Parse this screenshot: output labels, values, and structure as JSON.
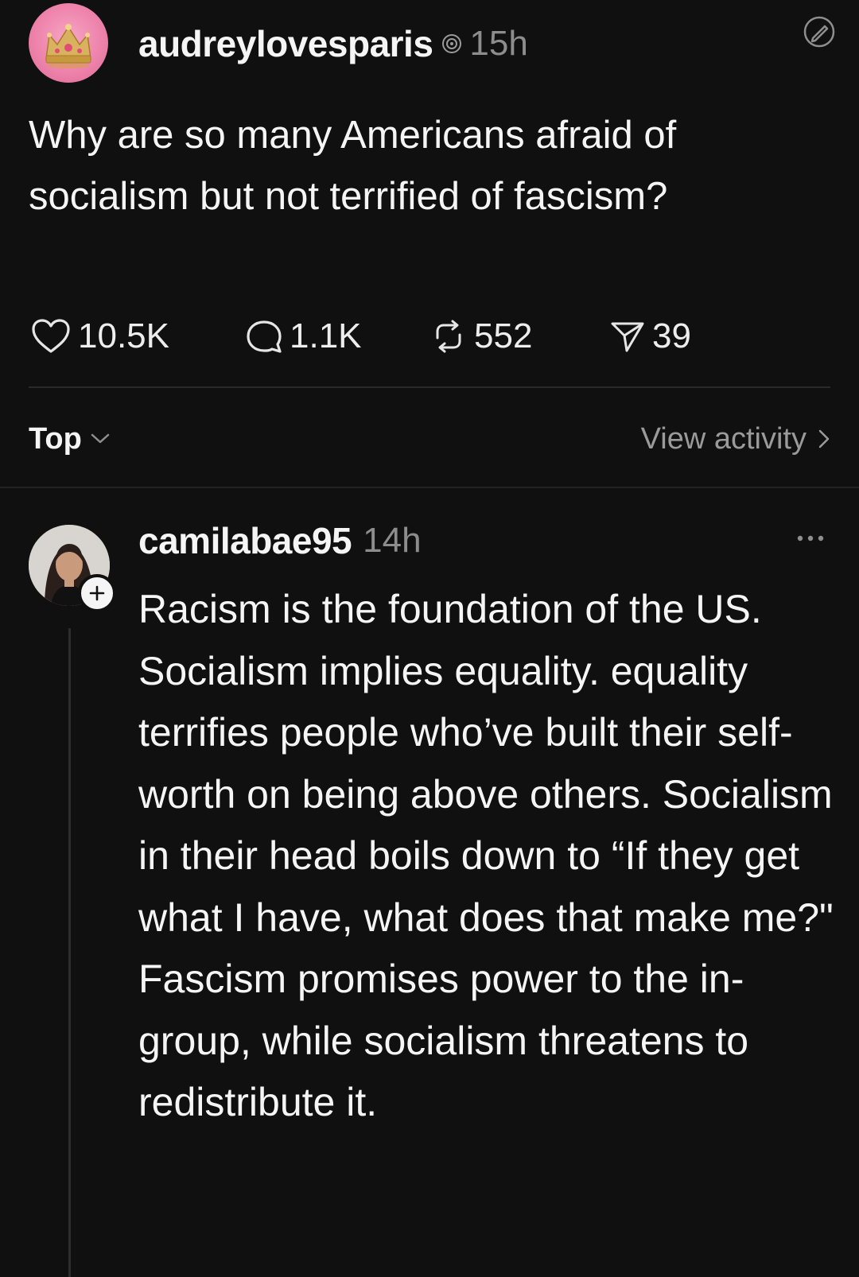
{
  "post": {
    "username": "audreylovesparis",
    "time": "15h",
    "text": "Why are so many Americans afraid of socialism but not terrified of fascism?",
    "avatar_icon": "crown-icon",
    "stats": {
      "likes": "10.5K",
      "replies": "1.1K",
      "reposts": "552",
      "shares": "39"
    }
  },
  "sort": {
    "label": "Top",
    "view_activity": "View activity"
  },
  "reply": {
    "username": "camilabae95",
    "time": "14h",
    "paragraphs": [
      "Racism is the foundation of the US. Socialism implies equality. equality terrifies people who’ve built their self-worth on being above others. Socialism in their head boils down to “If they get what I have, what does that make me?\"",
      "Fascism promises power to the in-group, while socialism threatens to redistribute it."
    ]
  },
  "colors": {
    "background": "#101010",
    "text": "#f5f5f5",
    "muted": "#8d8d8d",
    "avatar_pink": "#ee83ab"
  }
}
